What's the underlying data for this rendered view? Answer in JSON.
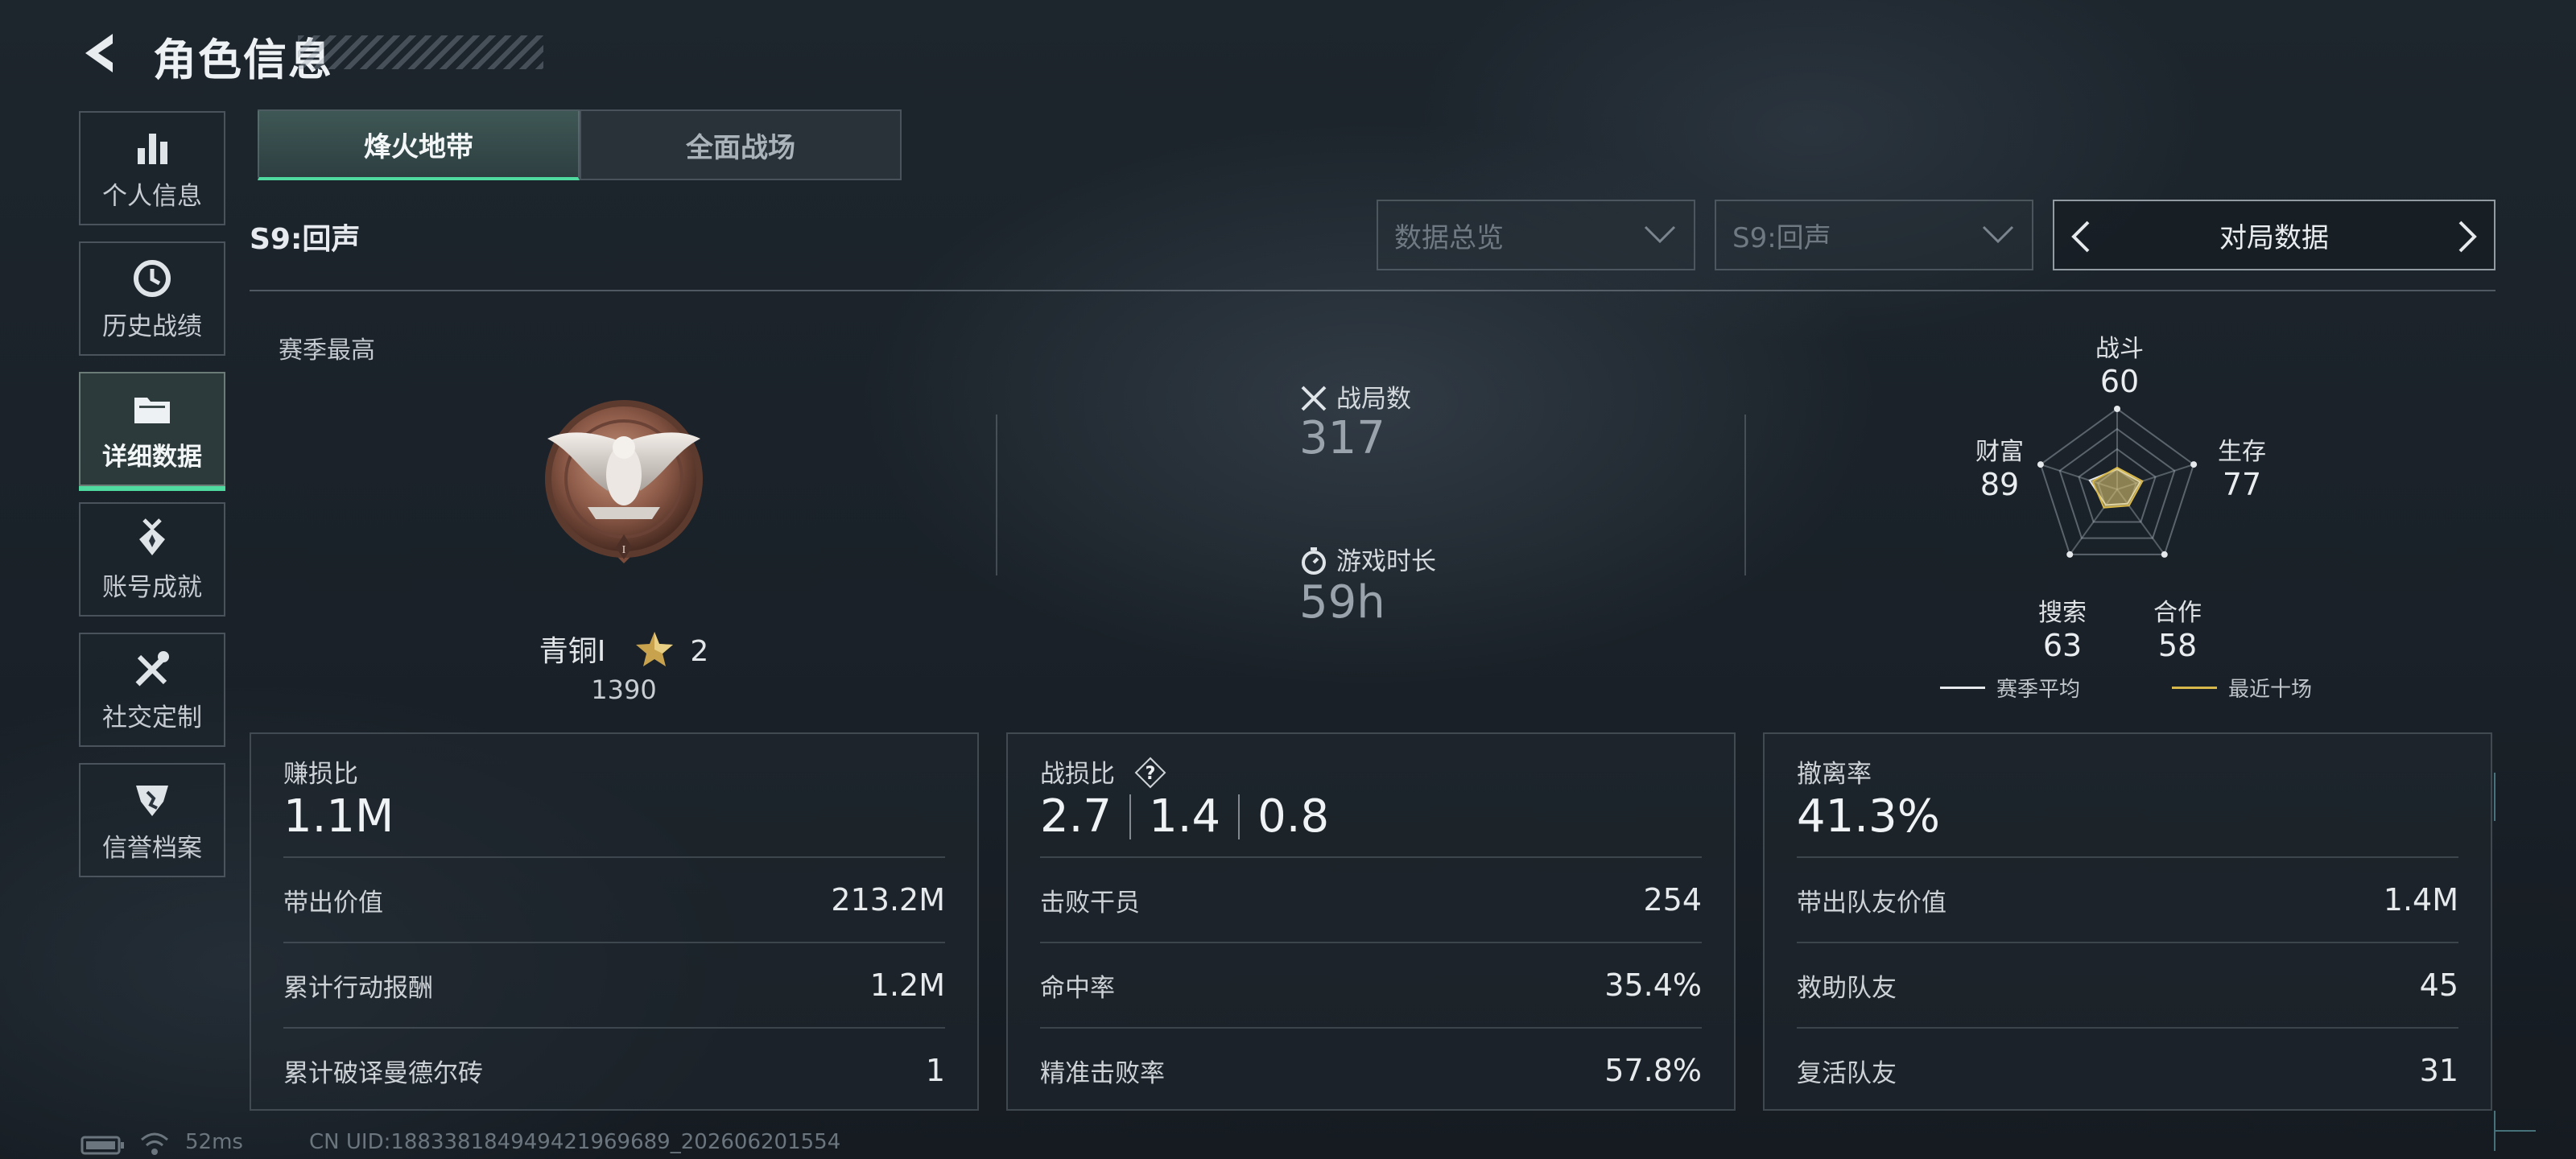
{
  "header": {
    "title": "角色信息"
  },
  "sidebar": {
    "items": [
      {
        "label": "个人信息",
        "icon": "bar-chart-icon"
      },
      {
        "label": "历史战绩",
        "icon": "clock-icon"
      },
      {
        "label": "详细数据",
        "icon": "folder-icon",
        "active": true
      },
      {
        "label": "账号成就",
        "icon": "medal-icon"
      },
      {
        "label": "社交定制",
        "icon": "tools-icon"
      },
      {
        "label": "信誉档案",
        "icon": "shield-icon"
      }
    ]
  },
  "tabs": [
    {
      "label": "烽火地带",
      "active": true
    },
    {
      "label": "全面战场",
      "active": false
    }
  ],
  "toolbar": {
    "season": "S9:回声",
    "filter1": "数据总览",
    "filter2": "S9:回声",
    "nav_label": "对局数据"
  },
  "peak": {
    "label": "赛季最高",
    "rank": "青铜I",
    "stars": "2",
    "score": "1390"
  },
  "stats": {
    "matches_label": "战局数",
    "matches_value": "317",
    "time_label": "游戏时长",
    "time_value": "59h"
  },
  "radar": {
    "axes": [
      {
        "label": "战斗",
        "value": "60"
      },
      {
        "label": "生存",
        "value": "77"
      },
      {
        "label": "合作",
        "value": "58"
      },
      {
        "label": "搜索",
        "value": "63"
      },
      {
        "label": "财富",
        "value": "89"
      }
    ],
    "season_avg": [
      0.25,
      0.3,
      0.22,
      0.24,
      0.36
    ],
    "recent_ten": [
      0.27,
      0.33,
      0.25,
      0.28,
      0.32
    ],
    "legend": {
      "season_avg": "赛季平均",
      "recent_ten": "最近十场"
    },
    "colors": {
      "season_avg": "#e6e9ec",
      "recent_ten": "#d8b84a"
    }
  },
  "cards": {
    "profit": {
      "title": "赚损比",
      "value": "1.1M",
      "rows": [
        {
          "k": "带出价值",
          "v": "213.2M"
        },
        {
          "k": "累计行动报酬",
          "v": "1.2M"
        },
        {
          "k": "累计破译曼德尔砖",
          "v": "1"
        }
      ]
    },
    "combat": {
      "title": "战损比",
      "values": [
        "2.7",
        "1.4",
        "0.8"
      ],
      "rows": [
        {
          "k": "击败干员",
          "v": "254"
        },
        {
          "k": "命中率",
          "v": "35.4%"
        },
        {
          "k": "精准击败率",
          "v": "57.8%"
        }
      ]
    },
    "extract": {
      "title": "撤离率",
      "value": "41.3%",
      "rows": [
        {
          "k": "带出队友价值",
          "v": "1.4M"
        },
        {
          "k": "救助队友",
          "v": "45"
        },
        {
          "k": "复活队友",
          "v": "31"
        }
      ]
    }
  },
  "footer": {
    "ping": "52ms",
    "uid": "CN UID:1883381849494219696​89_202606201554"
  },
  "accent": "#4fdba0"
}
